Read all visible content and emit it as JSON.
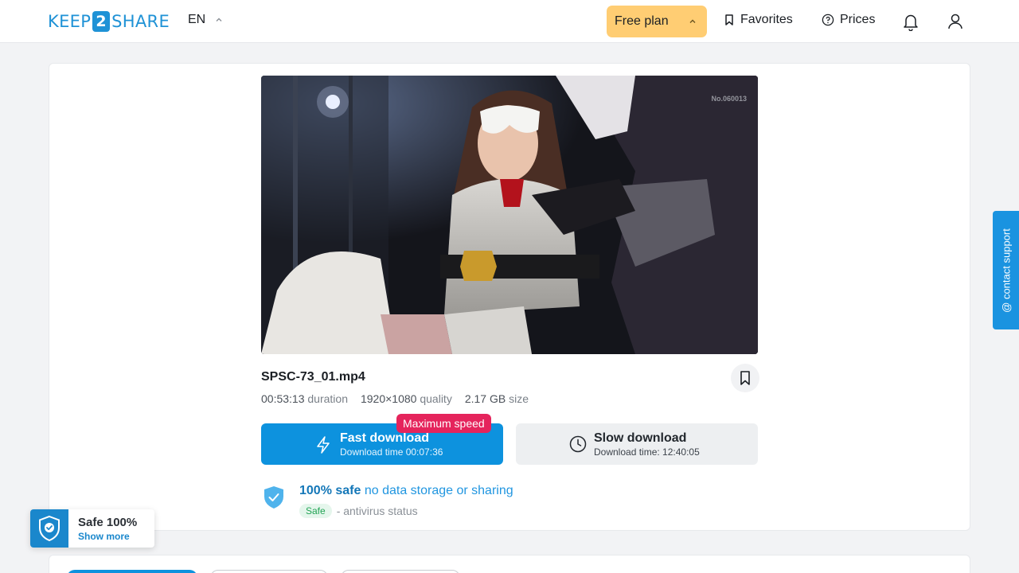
{
  "header": {
    "logo": {
      "part1": "KEEP",
      "num": "2",
      "part2": "SHARE"
    },
    "language": "EN",
    "plan": "Free plan",
    "favorites": "Favorites",
    "prices": "Prices",
    "icons": {
      "bell": "bell-icon",
      "user": "user-icon",
      "favorites": "bookmark-icon",
      "prices": "question-circle-icon"
    }
  },
  "file": {
    "name": "SPSC-73_01.mp4",
    "watermark": "No.060013",
    "duration_value": "00:53:13",
    "duration_label": "duration",
    "quality_value": "1920×1080",
    "quality_label": "quality",
    "size_value": "2.17 GB",
    "size_label": "size"
  },
  "download": {
    "badge": "Maximum speed",
    "fast_title": "Fast download",
    "fast_sub": "Download time 00:07:36",
    "slow_title": "Slow download",
    "slow_sub": "Download time: 12:40:05"
  },
  "safety": {
    "bold": "100% safe",
    "rest": "no data storage or sharing",
    "pill": "Safe",
    "status": "- antivirus status"
  },
  "contact_support": "@ contact support",
  "safe_badge": {
    "title": "Safe 100%",
    "link": "Show more"
  },
  "colors": {
    "accent": "#0d92de",
    "plan": "#ffcd73",
    "badge": "#e5245c"
  }
}
